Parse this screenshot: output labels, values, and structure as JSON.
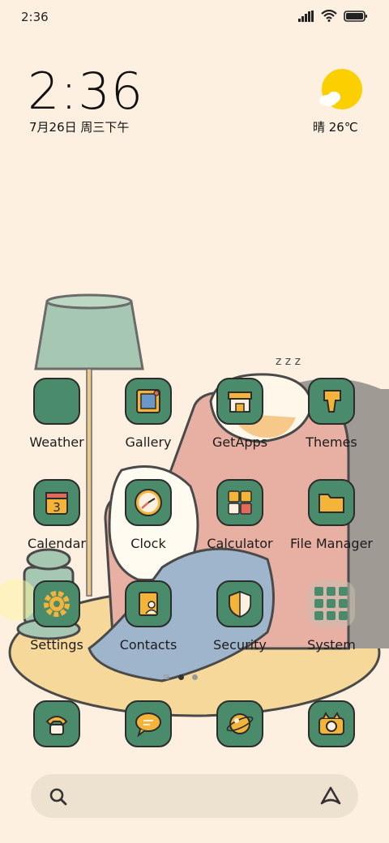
{
  "status_bar": {
    "time": "2:36",
    "icons": [
      "signal-icon",
      "wifi-icon",
      "battery-icon"
    ]
  },
  "clock_widget": {
    "time": "2:36",
    "date": "7月26日 周三下午"
  },
  "weather_widget": {
    "icon": "sun-cloud-icon",
    "text": "晴 26℃"
  },
  "apps": [
    {
      "label": "Weather",
      "icon": "weather-icon"
    },
    {
      "label": "Gallery",
      "icon": "gallery-icon"
    },
    {
      "label": "GetApps",
      "icon": "store-icon"
    },
    {
      "label": "Themes",
      "icon": "brush-icon"
    },
    {
      "label": "Calendar",
      "icon": "calendar-icon",
      "day": "3"
    },
    {
      "label": "Clock",
      "icon": "clock-icon"
    },
    {
      "label": "Calculator",
      "icon": "calculator-icon"
    },
    {
      "label": "File Manager",
      "icon": "folder-icon"
    },
    {
      "label": "Settings",
      "icon": "gear-icon"
    },
    {
      "label": "Contacts",
      "icon": "contacts-icon"
    },
    {
      "label": "Security",
      "icon": "shield-icon"
    },
    {
      "label": "System",
      "icon": "folder-grid-icon"
    }
  ],
  "dock": [
    {
      "icon": "phone-icon"
    },
    {
      "icon": "message-icon"
    },
    {
      "icon": "browser-icon"
    },
    {
      "icon": "camera-icon"
    }
  ],
  "page_indicator": {
    "pages": 2,
    "current": 1
  },
  "search_bar": {
    "left_icon": "search-icon",
    "right_icon": "assistant-icon"
  },
  "colors": {
    "background": "#fdf0e0",
    "icon_green": "#4a8b6c",
    "accent_yellow": "#f4b43a"
  }
}
